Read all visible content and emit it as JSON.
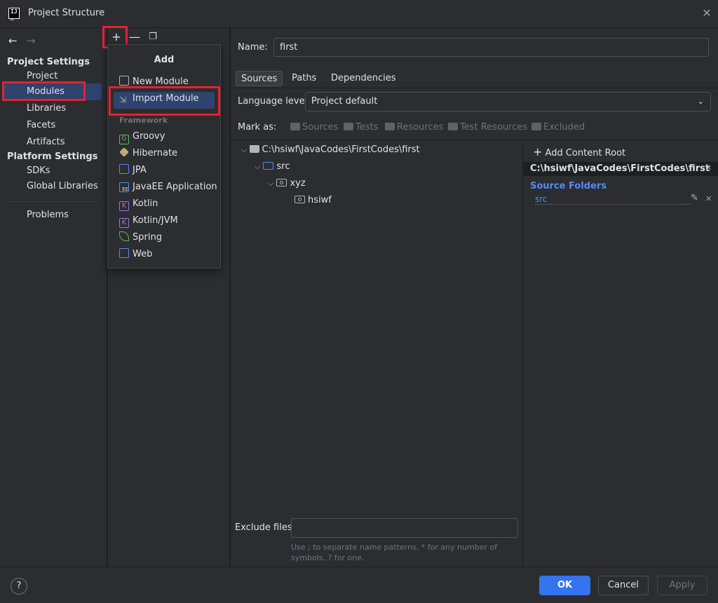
{
  "window": {
    "title": "Project Structure"
  },
  "nav": {
    "project_settings_header": "Project Settings",
    "project_settings_items": [
      "Project",
      "Modules",
      "Libraries",
      "Facets",
      "Artifacts"
    ],
    "platform_settings_header": "Platform Settings",
    "platform_settings_items": [
      "SDKs",
      "Global Libraries"
    ],
    "problems": "Problems",
    "selected": "Modules"
  },
  "toolbar": {
    "add_icon": "plus-icon",
    "remove_icon": "minus-icon",
    "copy_icon": "copy-icon"
  },
  "add_popup": {
    "title": "Add",
    "items": [
      "New Module",
      "Import Module"
    ],
    "selected": "Import Module",
    "framework_header": "Framework",
    "frameworks": [
      "Groovy",
      "Hibernate",
      "JPA",
      "JavaEE Application",
      "Kotlin",
      "Kotlin/JVM",
      "Spring",
      "Web"
    ]
  },
  "module": {
    "name_label": "Name:",
    "name_value": "first",
    "tabs": [
      "Sources",
      "Paths",
      "Dependencies"
    ],
    "active_tab": "Sources",
    "language_level_label": "Language level:",
    "language_level_value": "Project default",
    "mark_as_label": "Mark as:",
    "mark_as_options": [
      "Sources",
      "Tests",
      "Resources",
      "Test Resources",
      "Excluded"
    ],
    "tree": [
      {
        "label": "C:\\hsiwf\\JavaCodes\\FirstCodes\\first",
        "depth": 0
      },
      {
        "label": "src",
        "depth": 1
      },
      {
        "label": "xyz",
        "depth": 2
      },
      {
        "label": "hsiwf",
        "depth": 3
      }
    ],
    "exclude_label": "Exclude files:",
    "exclude_value": "",
    "exclude_hint_line1": "Use ; to separate name patterns, * for any number of",
    "exclude_hint_line2": "symbols, ? for one."
  },
  "content_root": {
    "add_label": "Add Content Root",
    "path": "C:\\hsiwf\\JavaCodes\\FirstCodes\\first",
    "source_folders_header": "Source Folders",
    "source_folders": [
      "src"
    ]
  },
  "footer": {
    "help": "?",
    "ok": "OK",
    "cancel": "Cancel",
    "apply": "Apply"
  },
  "colors": {
    "accent": "#3574f0",
    "selection": "#2e436e",
    "highlight_box": "#e5222c",
    "source_header": "#548af7"
  }
}
